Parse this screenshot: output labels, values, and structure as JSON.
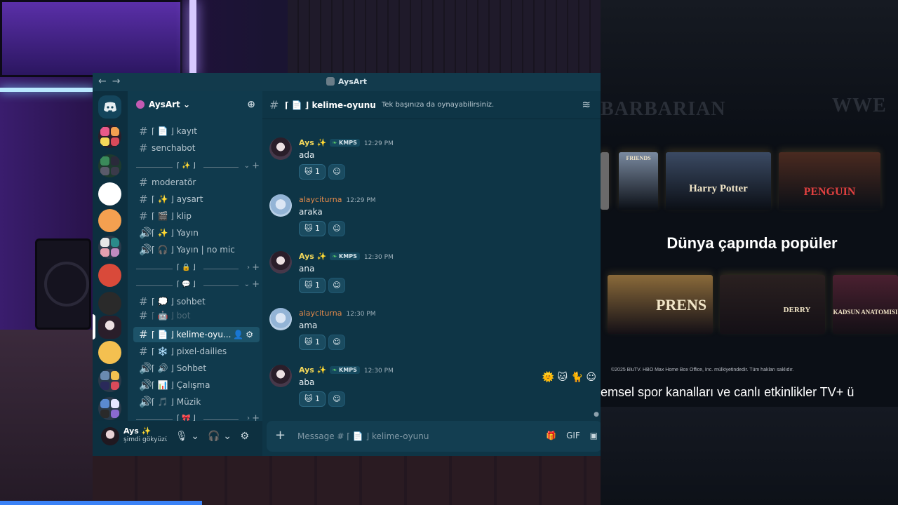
{
  "window": {
    "title": "AysArt",
    "back": "←",
    "forward": "→"
  },
  "server": {
    "name": "AysArt ⌄",
    "add_people": "⊕"
  },
  "channels": [
    {
      "prefix": "#",
      "emoji_color": "#d94a5a",
      "label": "⌈ 📄 ⌋ kayıt"
    },
    {
      "prefix": "#",
      "emoji_color": "",
      "label": "senchabot"
    },
    {
      "prefix": "#",
      "emoji_color": "",
      "label": "moderatör"
    },
    {
      "prefix": "#",
      "emoji_color": "#f4c75a",
      "label": "⌈ ✨ ⌋ aysart"
    },
    {
      "prefix": "#",
      "emoji_color": "#8b7bd8",
      "label": "⌈ 🎬 ⌋ klip"
    },
    {
      "prefix": "🔊",
      "emoji_color": "#f4c75a",
      "label": "⌈ ✨ ⌋ Yayın"
    },
    {
      "prefix": "🔊",
      "emoji_color": "#c8d6dd",
      "label": "⌈ 🎧 ⌋ Yayın | no mic"
    },
    {
      "prefix": "#",
      "emoji_color": "#c8d6dd",
      "label": "⌈ 💭 ⌋ sohbet"
    },
    {
      "prefix": "#",
      "emoji_color": "",
      "label": "⌈ 🤖 ⌋ bot"
    },
    {
      "prefix": "#",
      "emoji_color": "#d94a5a",
      "label": "⌈ 📄 ⌋ kelime-oyu..."
    },
    {
      "prefix": "#",
      "emoji_color": "#9ec6e6",
      "label": "⌈ ❄️ ⌋ pixel-dailies"
    },
    {
      "prefix": "🔊",
      "emoji_color": "#c8d6dd",
      "label": "⌈ 🔊 ⌋ Sohbet"
    },
    {
      "prefix": "🔊",
      "emoji_color": "#5ad06a",
      "label": "⌈ 📊 ⌋ Çalışma"
    },
    {
      "prefix": "🔊",
      "emoji_color": "#8b7bd8",
      "label": "⌈ 🎵 ⌋ Müzik"
    }
  ],
  "categories": [
    {
      "emoji": "⌈ ✨ ⌋",
      "arrow": "⌄",
      "plus": "+"
    },
    {
      "emoji": "⌈ 🔒 ⌋",
      "arrow": "›",
      "plus": "+"
    },
    {
      "emoji": "⌈ 💬 ⌋",
      "arrow": "⌄",
      "plus": "+"
    },
    {
      "emoji": "⌈ 🎀 ⌋",
      "arrow": "›",
      "plus": "+"
    }
  ],
  "active_channel_tools": "👤⚙",
  "user": {
    "name": "Ays ✨",
    "status": "şimdi gökyüzü"
  },
  "user_controls": {
    "mic": "🎙 ⌄",
    "headset": "🎧 ⌄",
    "settings": "⚙"
  },
  "chat": {
    "channel_name": "⌈ 📄 ⌋ kelime-oyunu",
    "topic": "Tek başınıza da oynayabilirsiniz.",
    "threads_icon": "≋",
    "placeholder": "Message # ⌈ 📄 ⌋ kelime-oyunu",
    "composer_icons": {
      "gift": "🎁",
      "gif": "GIF",
      "sticker": "▣"
    },
    "plus": "+"
  },
  "messages": [
    {
      "author": "Ays",
      "spark": "✨",
      "tag": "KMPS",
      "time": "12:29 PM",
      "text": "ada",
      "react_count": "1",
      "kind": "ays"
    },
    {
      "author": "alayciturna",
      "spark": "",
      "tag": "",
      "time": "12:29 PM",
      "text": "araka",
      "react_count": "1",
      "kind": "alay"
    },
    {
      "author": "Ays",
      "spark": "✨",
      "tag": "KMPS",
      "time": "12:30 PM",
      "text": "ana",
      "react_count": "1",
      "kind": "ays"
    },
    {
      "author": "alayciturna",
      "spark": "",
      "tag": "",
      "time": "12:30 PM",
      "text": "ama",
      "react_count": "1",
      "kind": "alay"
    },
    {
      "author": "Ays",
      "spark": "✨",
      "tag": "KMPS",
      "time": "12:30 PM",
      "text": "aba",
      "react_count": "1",
      "kind": "ays"
    }
  ],
  "react_emoji": "🐱",
  "add_react": "☺",
  "hover_tools": "🌞 🐱 🐈 ☺",
  "ad": {
    "faded_left": "BARBARIAN",
    "faded_right": "WWE",
    "posters_top": [
      {
        "title": "FRIENDS",
        "color": "#7a8aa0"
      },
      {
        "title": "Harry Potter",
        "color": "#3b4a63"
      },
      {
        "title": "PENGUIN",
        "color": "#4a2a20"
      }
    ],
    "heading": "Dünya çapında popüler",
    "posters_bottom": [
      {
        "title": "PRENS",
        "color": "#8a6a3a"
      },
      {
        "title": "",
        "color": "#2a2020"
      },
      {
        "title": "DERRY",
        "color": "#3a2a2a"
      },
      {
        "title": "KADSUN ANATOMISI",
        "color": "#4a2030"
      }
    ],
    "copyright": "©2025 BluTV. HBO Max Home Box Office, Inc. mülkiyetindedir. Tüm hakları saklıdır.",
    "ticker": "emsel spor kanalları ve canlı etkinlikler TV+ ü"
  },
  "stream": {
    "progress_fraction": 0.225
  }
}
